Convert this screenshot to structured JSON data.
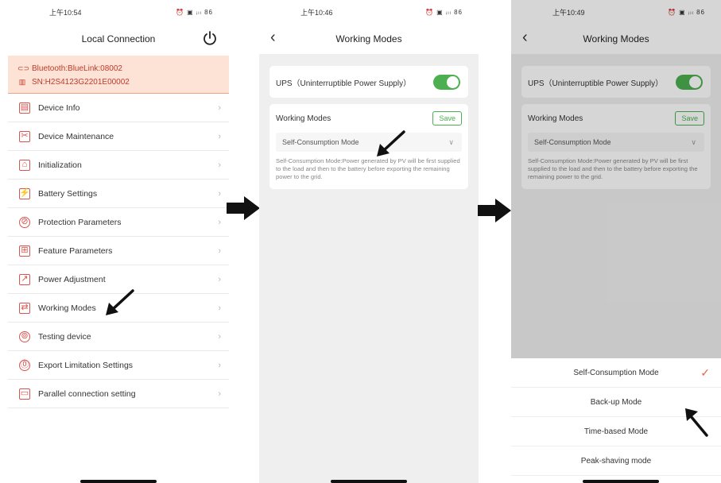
{
  "panel1": {
    "status_time": "上午10:54",
    "status_icons": "⏰ ▣ ᵢₗₗ 86",
    "title": "Local Connection",
    "bluetooth": "Bluetooth:BlueLink:08002",
    "serial": "SN:H2S4123G2201E00002",
    "menu": [
      {
        "label": "Device Info",
        "icon": "▤"
      },
      {
        "label": "Device Maintenance",
        "icon": "✂"
      },
      {
        "label": "Initialization",
        "icon": "⌂"
      },
      {
        "label": "Battery Settings",
        "icon": "⚡"
      },
      {
        "label": "Protection Parameters",
        "icon": "⊘"
      },
      {
        "label": "Feature Parameters",
        "icon": "⊞"
      },
      {
        "label": "Power Adjustment",
        "icon": "↗"
      },
      {
        "label": "Working Modes",
        "icon": "⇄"
      },
      {
        "label": "Testing device",
        "icon": "⊚"
      },
      {
        "label": "Export Limitation Settings",
        "icon": "⓪"
      },
      {
        "label": "Parallel connection setting",
        "icon": "▭"
      }
    ]
  },
  "panel2": {
    "status_time": "上午10:46",
    "status_icons": "⏰ ▣ ᵢₗₗ 86",
    "title": "Working Modes",
    "ups_label": "UPS（Uninterruptible Power Supply）",
    "modes_label": "Working Modes",
    "save_label": "Save",
    "selected_mode": "Self-Consumption Mode",
    "description": "Self-Consumption Mode:Power generated by PV will be first supplied to the load and then to the battery before exporting the remaining power to the grid."
  },
  "panel3": {
    "status_time": "上午10:49",
    "status_icons": "⏰ ▣ ᵢₗₗ 86",
    "title": "Working Modes",
    "ups_label": "UPS（Uninterruptible Power Supply）",
    "modes_label": "Working Modes",
    "save_label": "Save",
    "selected_mode": "Self-Consumption Mode",
    "description": "Self-Consumption Mode:Power generated by PV will be first supplied to the load and then to the battery before exporting the remaining power to the grid.",
    "options": [
      "Self-Consumption Mode",
      "Back-up Mode",
      "Time-based Mode",
      "Peak-shaving mode"
    ]
  },
  "colors": {
    "accent_red": "#d9534f",
    "toggle_green": "#4caf50",
    "conn_bg": "#fde3d6"
  }
}
